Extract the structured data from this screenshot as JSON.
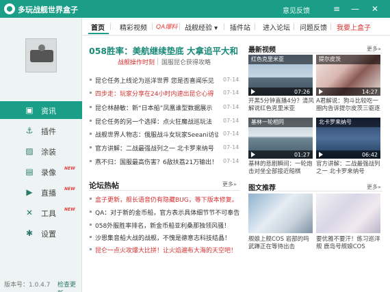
{
  "window": {
    "title": "多玩战舰世界盒子",
    "feedback": "意见反馈",
    "menu_icon": "menu-icon",
    "minimize_icon": "minimize-icon",
    "close_icon": "close-icon"
  },
  "tabs": [
    {
      "label": "首页"
    },
    {
      "label": "精彩视频"
    },
    {
      "label": "QA爆料"
    },
    {
      "label": "战舰经验 ▾"
    },
    {
      "label": "插件站"
    },
    {
      "label": "进入论坛"
    },
    {
      "label": "问题反馈"
    },
    {
      "label": "我要上盒子"
    }
  ],
  "sidebar": {
    "items": [
      {
        "label": "资讯",
        "icon": "news-icon"
      },
      {
        "label": "插件",
        "icon": "anchor-icon"
      },
      {
        "label": "涂装",
        "icon": "paint-icon"
      },
      {
        "label": "录像",
        "icon": "video-icon",
        "badge": "NEW"
      },
      {
        "label": "直播",
        "icon": "live-icon",
        "badge": "NEW"
      },
      {
        "label": "工具",
        "icon": "tools-icon",
        "badge": "NEW"
      },
      {
        "label": "设置",
        "icon": "gear-icon"
      }
    ],
    "version": "版本号：1.0.4.7",
    "check_update": "检查更新"
  },
  "headline": {
    "title": "058胜率：美航继续垫底 大拿追平大和",
    "sub_red": "战舰操作时刻",
    "sub_gray": "国服昆仑获得攻略"
  },
  "news": [
    {
      "text": "昆仑任务上线论为巡洋世界 您是否喜闻乐见",
      "date": "07-14",
      "red": false
    },
    {
      "text": "四步走：玩家分享在24小时内速出昆仑心得",
      "date": "07-14",
      "red": true
    },
    {
      "text": "昆仑林赫敏：新“日本船”凤凰谁型数据展示",
      "date": "07-14",
      "red": false
    },
    {
      "text": "昆仑任务的另一个选择：点火狂魔战巡玩法",
      "date": "07-14",
      "red": false
    },
    {
      "text": "战舰世界人物志：俄服战斗女玩家Seeani访谈",
      "date": "07-14",
      "red": false
    },
    {
      "text": "官方讲解：二战最强战列之一 北卡罗来纳号",
      "date": "07-14",
      "red": false
    },
    {
      "text": "燕不归：国服最高伤害？6敌扶荔21万输出！",
      "date": "07-14",
      "red": false
    }
  ],
  "forum": {
    "title": "论坛热帖",
    "more": "更多»",
    "items": [
      {
        "text": "盒子更新，舰长语音仍有隐藏BUG，等下版本修复。",
        "red": true
      },
      {
        "text": "QA：对于新的金币船，官方表示具体细节节不可奉告！",
        "red": false
      },
      {
        "text": "058外服胜率排名，新金币船亚利桑那独领风骚！",
        "red": false
      },
      {
        "text": "沙恩集音船大战的战舰，不愧是德意志科技结晶！",
        "red": false
      },
      {
        "text": "昆仑一点火攻爆大比拼！让火焰遍布大海的天空吧！",
        "red": true
      }
    ]
  },
  "videos": {
    "title": "最新视频",
    "more": "更多»",
    "items": [
      {
        "strip": "红色克里米亚",
        "duration": "07:26",
        "caption": "开黑5分钟直播4分？清风解说红色克里米亚"
      },
      {
        "strip": "提尔皮茨",
        "duration": "14:27",
        "caption": "A君解说：狗斗比较吃一圈内告诉提尔皮茨三驱逐"
      },
      {
        "strip": "基林一轮相同",
        "duration": "01:27",
        "caption": "基林的悲剧瞬间：一轮炮击对坐全部接近船棋"
      },
      {
        "strip": "北卡罗来纳号",
        "duration": "06:42",
        "caption": "官方讲解：二战最强战列之一 北卡罗来纳号"
      }
    ]
  },
  "images": {
    "title": "图文推荐",
    "more": "更多»",
    "items": [
      {
        "caption": "舰娘上舰COS 岩部的吗武蹲正在等待出击"
      },
      {
        "caption": "要优雅不要汗！练习巡洋舰 鹿岛号舰娘COS"
      }
    ]
  }
}
